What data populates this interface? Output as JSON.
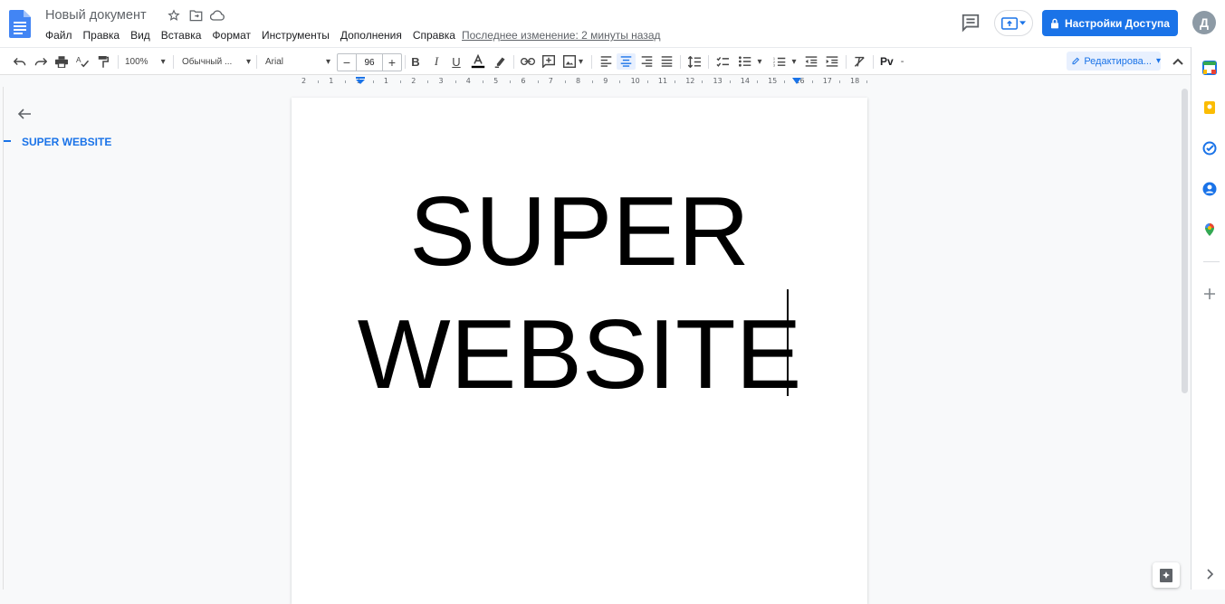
{
  "document": {
    "title": "Новый документ",
    "last_edit": "Последнее изменение: 2 минуты назад",
    "body_lines": [
      "SUPER",
      "WEBSITE"
    ]
  },
  "menu": [
    "Файл",
    "Правка",
    "Вид",
    "Вставка",
    "Формат",
    "Инструменты",
    "Дополнения",
    "Справка"
  ],
  "header": {
    "share_label": "Настройки Доступа",
    "avatar_letter": "Д"
  },
  "toolbar": {
    "zoom": "100%",
    "style": "Обычный ...",
    "font": "Arial",
    "font_size": "96",
    "font_size_minus": "−",
    "font_size_plus": "+",
    "input_tools": "Pv",
    "input_tools_dash": "-",
    "edit_mode": "Редактирова..."
  },
  "ruler": {
    "labels": [
      "2",
      "1",
      "1",
      "1",
      "2",
      "3",
      "4",
      "5",
      "6",
      "7",
      "8",
      "9",
      "10",
      "11",
      "12",
      "13",
      "14",
      "15",
      "16",
      "17",
      "18"
    ]
  },
  "outline": {
    "items": [
      "SUPER WEBSITE"
    ]
  },
  "colors": {
    "accent": "#1a73e8",
    "share_bg": "#1a73e8",
    "doc_icon": "#4285f4",
    "avatar_bg": "#8d9aa5"
  },
  "icons": [
    "docs-logo-icon",
    "star-icon",
    "move-to-folder-icon",
    "cloud-saved-icon",
    "comment-history-icon",
    "present-icon",
    "lock-icon",
    "undo-icon",
    "redo-icon",
    "print-icon",
    "spellcheck-icon",
    "paint-format-icon",
    "bold-icon",
    "italic-icon",
    "underline-icon",
    "text-color-icon",
    "highlight-icon",
    "link-icon",
    "add-comment-icon",
    "insert-image-icon",
    "align-left-icon",
    "align-center-icon",
    "align-right-icon",
    "align-justify-icon",
    "line-spacing-icon",
    "checklist-icon",
    "bulleted-list-icon",
    "numbered-list-icon",
    "decrease-indent-icon",
    "increase-indent-icon",
    "clear-formatting-icon",
    "pencil-icon",
    "chevron-up-icon",
    "back-arrow-icon",
    "calendar-icon",
    "keep-icon",
    "tasks-icon",
    "contacts-icon",
    "maps-icon",
    "plus-icon",
    "chevron-right-icon",
    "explore-icon"
  ]
}
